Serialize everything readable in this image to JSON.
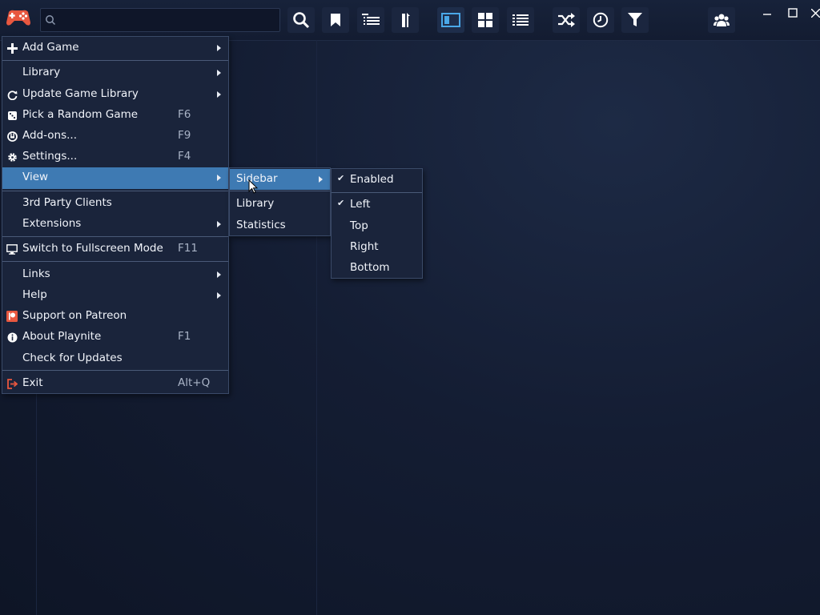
{
  "search": {
    "placeholder": "",
    "value": ""
  },
  "toolbar": {
    "buttons": [
      {
        "icon": "search-icon"
      },
      {
        "icon": "bookmark-icon"
      },
      {
        "icon": "grouping-list-icon"
      },
      {
        "icon": "sort-icon"
      },
      {
        "icon": "details-view-icon",
        "active": true
      },
      {
        "icon": "grid-view-icon"
      },
      {
        "icon": "list-view-icon"
      },
      {
        "icon": "shuffle-icon"
      },
      {
        "icon": "clock-icon"
      },
      {
        "icon": "filter-icon"
      },
      {
        "icon": "friends-icon"
      }
    ]
  },
  "main_menu": {
    "items": [
      {
        "label": "Add Game",
        "icon": "plus-icon",
        "submenu": true
      },
      {
        "label": "Library",
        "submenu": true
      },
      {
        "label": "Update Game Library",
        "icon": "refresh-icon",
        "submenu": true
      },
      {
        "label": "Pick a Random Game",
        "icon": "dice-icon",
        "shortcut": "F6"
      },
      {
        "label": "Add-ons...",
        "icon": "power-plug-icon",
        "shortcut": "F9"
      },
      {
        "label": "Settings...",
        "icon": "gear-icon",
        "shortcut": "F4"
      },
      {
        "label": "View",
        "submenu": true,
        "highlighted": true
      },
      {
        "label": "3rd Party Clients"
      },
      {
        "label": "Extensions",
        "submenu": true
      },
      {
        "label": "Switch to Fullscreen Mode",
        "icon": "monitor-icon",
        "shortcut": "F11"
      },
      {
        "label": "Links",
        "submenu": true
      },
      {
        "label": "Help",
        "submenu": true
      },
      {
        "label": "Support on Patreon",
        "icon": "patreon-icon"
      },
      {
        "label": "About Playnite",
        "icon": "info-icon",
        "shortcut": "F1"
      },
      {
        "label": "Check for Updates"
      },
      {
        "label": "Exit",
        "icon": "exit-icon",
        "shortcut": "Alt+Q"
      }
    ]
  },
  "view_menu": {
    "items": [
      {
        "label": "Sidebar",
        "submenu": true,
        "highlighted": true
      },
      {
        "label": "Library"
      },
      {
        "label": "Statistics"
      }
    ]
  },
  "sidebar_menu": {
    "items": [
      {
        "label": "Enabled",
        "checked": true
      },
      {
        "label": "Left",
        "checked": true
      },
      {
        "label": "Top",
        "checked": false
      },
      {
        "label": "Right",
        "checked": false
      },
      {
        "label": "Bottom",
        "checked": false
      }
    ]
  },
  "colors": {
    "highlight": "#3e7ab3",
    "background": "#141d33",
    "menu": "#1a243b",
    "logo": "#e8573f"
  }
}
